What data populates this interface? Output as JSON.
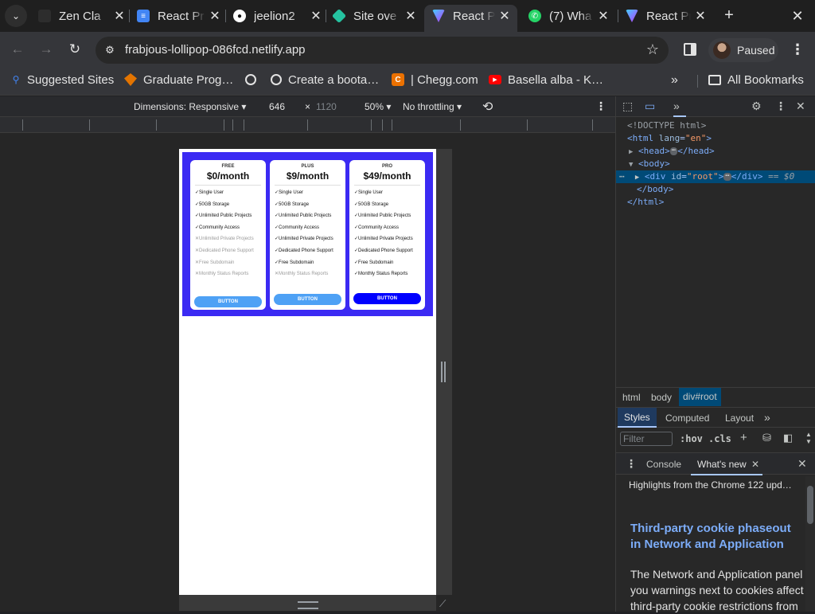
{
  "tabs": [
    {
      "title": "Zen Cla",
      "icon": "zen-icon",
      "color": "#2d2d2d"
    },
    {
      "title": "React Pr",
      "icon": "docs-icon",
      "color": "#4285f4"
    },
    {
      "title": "jeelion2",
      "icon": "github-icon",
      "color": "#ffffff"
    },
    {
      "title": "Site ove",
      "icon": "netlify-icon",
      "color": "#25c2a0"
    },
    {
      "title": "React Pr",
      "icon": "vite-icon",
      "color": "#a259ff",
      "active": true
    },
    {
      "title": "(7) Wha",
      "icon": "whatsapp-icon",
      "color": "#25d366"
    },
    {
      "title": "React Pr",
      "icon": "vite-icon",
      "color": "#a259ff"
    }
  ],
  "toolbar": {
    "url": "frabjous-lollipop-086fcd.netlify.app",
    "profile_label": "Paused"
  },
  "bookmarks": {
    "items": [
      {
        "label": "Suggested Sites",
        "icon": "search-icon"
      },
      {
        "label": "Graduate Prog…",
        "icon": "graduate-icon"
      },
      {
        "label": "",
        "icon": "globe-icon"
      },
      {
        "label": "Create a boota…",
        "icon": "globe-icon"
      },
      {
        "label": "| Chegg.com",
        "icon": "chegg-icon"
      },
      {
        "label": "Basella alba - K…",
        "icon": "youtube-icon"
      }
    ],
    "all_label": "All Bookmarks"
  },
  "device_toolbar": {
    "dimensions_label": "Dimensions: Responsive",
    "width": "646",
    "times": "×",
    "height": "1120",
    "zoom": "50%",
    "throttling": "No throttling"
  },
  "pricing": {
    "plans": [
      {
        "name": "FREE",
        "price": "$0/month",
        "features": [
          {
            "text": "Single User",
            "included": true
          },
          {
            "text": "50GB Storage",
            "included": true
          },
          {
            "text": "Unlimited Public Projects",
            "included": true
          },
          {
            "text": "Community Access",
            "included": true
          },
          {
            "text": "Unlimited Private Projects",
            "included": false
          },
          {
            "text": "Dedicated Phone Support",
            "included": false
          },
          {
            "text": "Free Subdomain",
            "included": false
          },
          {
            "text": "Monthly Status Reports",
            "included": false
          }
        ],
        "button": "BUTTON",
        "button_color": "#4ea1f5"
      },
      {
        "name": "PLUS",
        "price": "$9/month",
        "features": [
          {
            "text": "Single User",
            "included": true
          },
          {
            "text": "50GB Storage",
            "included": true
          },
          {
            "text": "Unlimited Public Projects",
            "included": true
          },
          {
            "text": "Community Access",
            "included": true
          },
          {
            "text": "Unlimited Private Projects",
            "included": true
          },
          {
            "text": "Dedicated Phone Support",
            "included": true
          },
          {
            "text": "Free Subdomain",
            "included": true
          },
          {
            "text": "Monthly Status Reports",
            "included": false
          }
        ],
        "button": "BUTTON",
        "button_color": "#4ea1f5"
      },
      {
        "name": "PRO",
        "price": "$49/month",
        "features": [
          {
            "text": "Single User",
            "included": true
          },
          {
            "text": "50GB Storage",
            "included": true
          },
          {
            "text": "Unlimited Public Projects",
            "included": true
          },
          {
            "text": "Community Access",
            "included": true
          },
          {
            "text": "Unlimited Private Projects",
            "included": true
          },
          {
            "text": "Dedicated Phone Support",
            "included": true
          },
          {
            "text": "Free Subdomain",
            "included": true
          },
          {
            "text": "Monthly Status Reports",
            "included": true
          }
        ],
        "button": "BUTTON",
        "button_color": "#0000ff"
      }
    ],
    "background": "#3b2af3"
  },
  "devtools": {
    "elements": {
      "doctype": "<!DOCTYPE html>",
      "html_open_tag": "<html",
      "html_attr_name": "lang",
      "html_attr_value": "\"en\"",
      "gt": ">",
      "head_open": "<head>",
      "head_close": "</head>",
      "body_open": "<body>",
      "div_open": "<div",
      "div_attr_name": "id",
      "div_attr_value": "\"root\"",
      "div_close": "</div>",
      "eq_marker": "== $0",
      "body_close": "</body>",
      "html_close": "</html>",
      "ellipsis": "⋯"
    },
    "breadcrumbs": [
      "html",
      "body",
      "div#root"
    ],
    "styles_tabs": [
      "Styles",
      "Computed",
      "Layout"
    ],
    "filter_placeholder": "Filter",
    "hov": ":hov",
    "cls": ".cls",
    "drawer_tabs": [
      "Console",
      "What's new"
    ],
    "whats_new": {
      "heading": "Highlights from the Chrome 122 upd…",
      "title_line1": "Third-party cookie phaseout",
      "title_line2": "in Network and Application",
      "body_line1": "The Network and Application panel",
      "body_line2": "you warnings next to cookies affect",
      "body_line3": "third-party cookie restrictions from"
    }
  }
}
